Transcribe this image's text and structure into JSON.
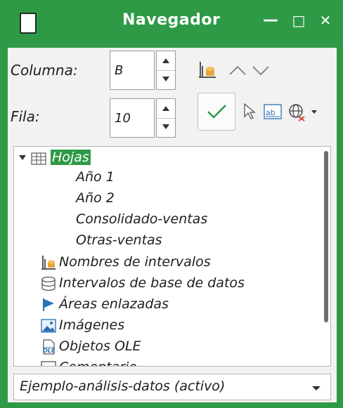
{
  "window": {
    "title": "Navegador",
    "minimize_glyph": "—",
    "maximize_glyph": "□",
    "close_glyph": "✕",
    "accent_color": "#2e9a46"
  },
  "controls": {
    "column_label": "Columna:",
    "column_value": "B",
    "row_label": "Fila:",
    "row_value": "10",
    "toolbar_icons": [
      "range-names-icon",
      "previous-icon",
      "next-icon",
      "toggle-check-icon",
      "drag-mode-icon",
      "insert-as-hyperlink-icon",
      "documents-globe-icon",
      "dropdown-icon"
    ]
  },
  "tree": {
    "root": {
      "label": "Hojas",
      "icon": "table-icon",
      "expanded": true,
      "children": [
        "Año 1",
        "Año 2",
        "Consolidado-ventas",
        "Otras-ventas"
      ]
    },
    "categories": [
      {
        "label": "Nombres de intervalos",
        "icon": "range-names-icon"
      },
      {
        "label": "Intervalos de base de datos",
        "icon": "database-icon"
      },
      {
        "label": "Áreas enlazadas",
        "icon": "flag-icon"
      },
      {
        "label": "Imágenes",
        "icon": "image-icon"
      },
      {
        "label": "Objetos OLE",
        "icon": "ole-icon"
      },
      {
        "label": "Comentario",
        "icon": "comment-icon"
      }
    ]
  },
  "document_select": {
    "value": "Ejemplo-análisis-datos (activo)"
  }
}
